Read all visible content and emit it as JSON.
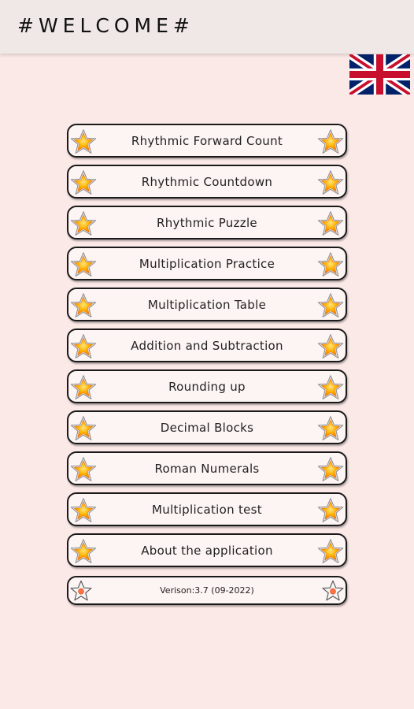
{
  "header": {
    "title": "#WELCOME#",
    "language_flag": "uk-flag-icon"
  },
  "menu": {
    "items": [
      {
        "label": "Rhythmic Forward Count"
      },
      {
        "label": "Rhythmic Countdown"
      },
      {
        "label": "Rhythmic Puzzle"
      },
      {
        "label": "Multiplication Practice"
      },
      {
        "label": "Multiplication Table"
      },
      {
        "label": "Addition and Subtraction"
      },
      {
        "label": "Rounding up"
      },
      {
        "label": "Decimal Blocks"
      },
      {
        "label": "Roman Numerals"
      },
      {
        "label": "Multiplication test"
      },
      {
        "label": "About the application"
      }
    ],
    "version": "Verison:3.7 (09-2022)"
  },
  "icons": {
    "menu_star": "star-icon",
    "version_star": "outline-star-icon"
  },
  "colors": {
    "background": "#fbe9e7",
    "appbar": "#efe8e6",
    "star_fill": "#ffb300",
    "star_outline": "#9e9e9e"
  }
}
